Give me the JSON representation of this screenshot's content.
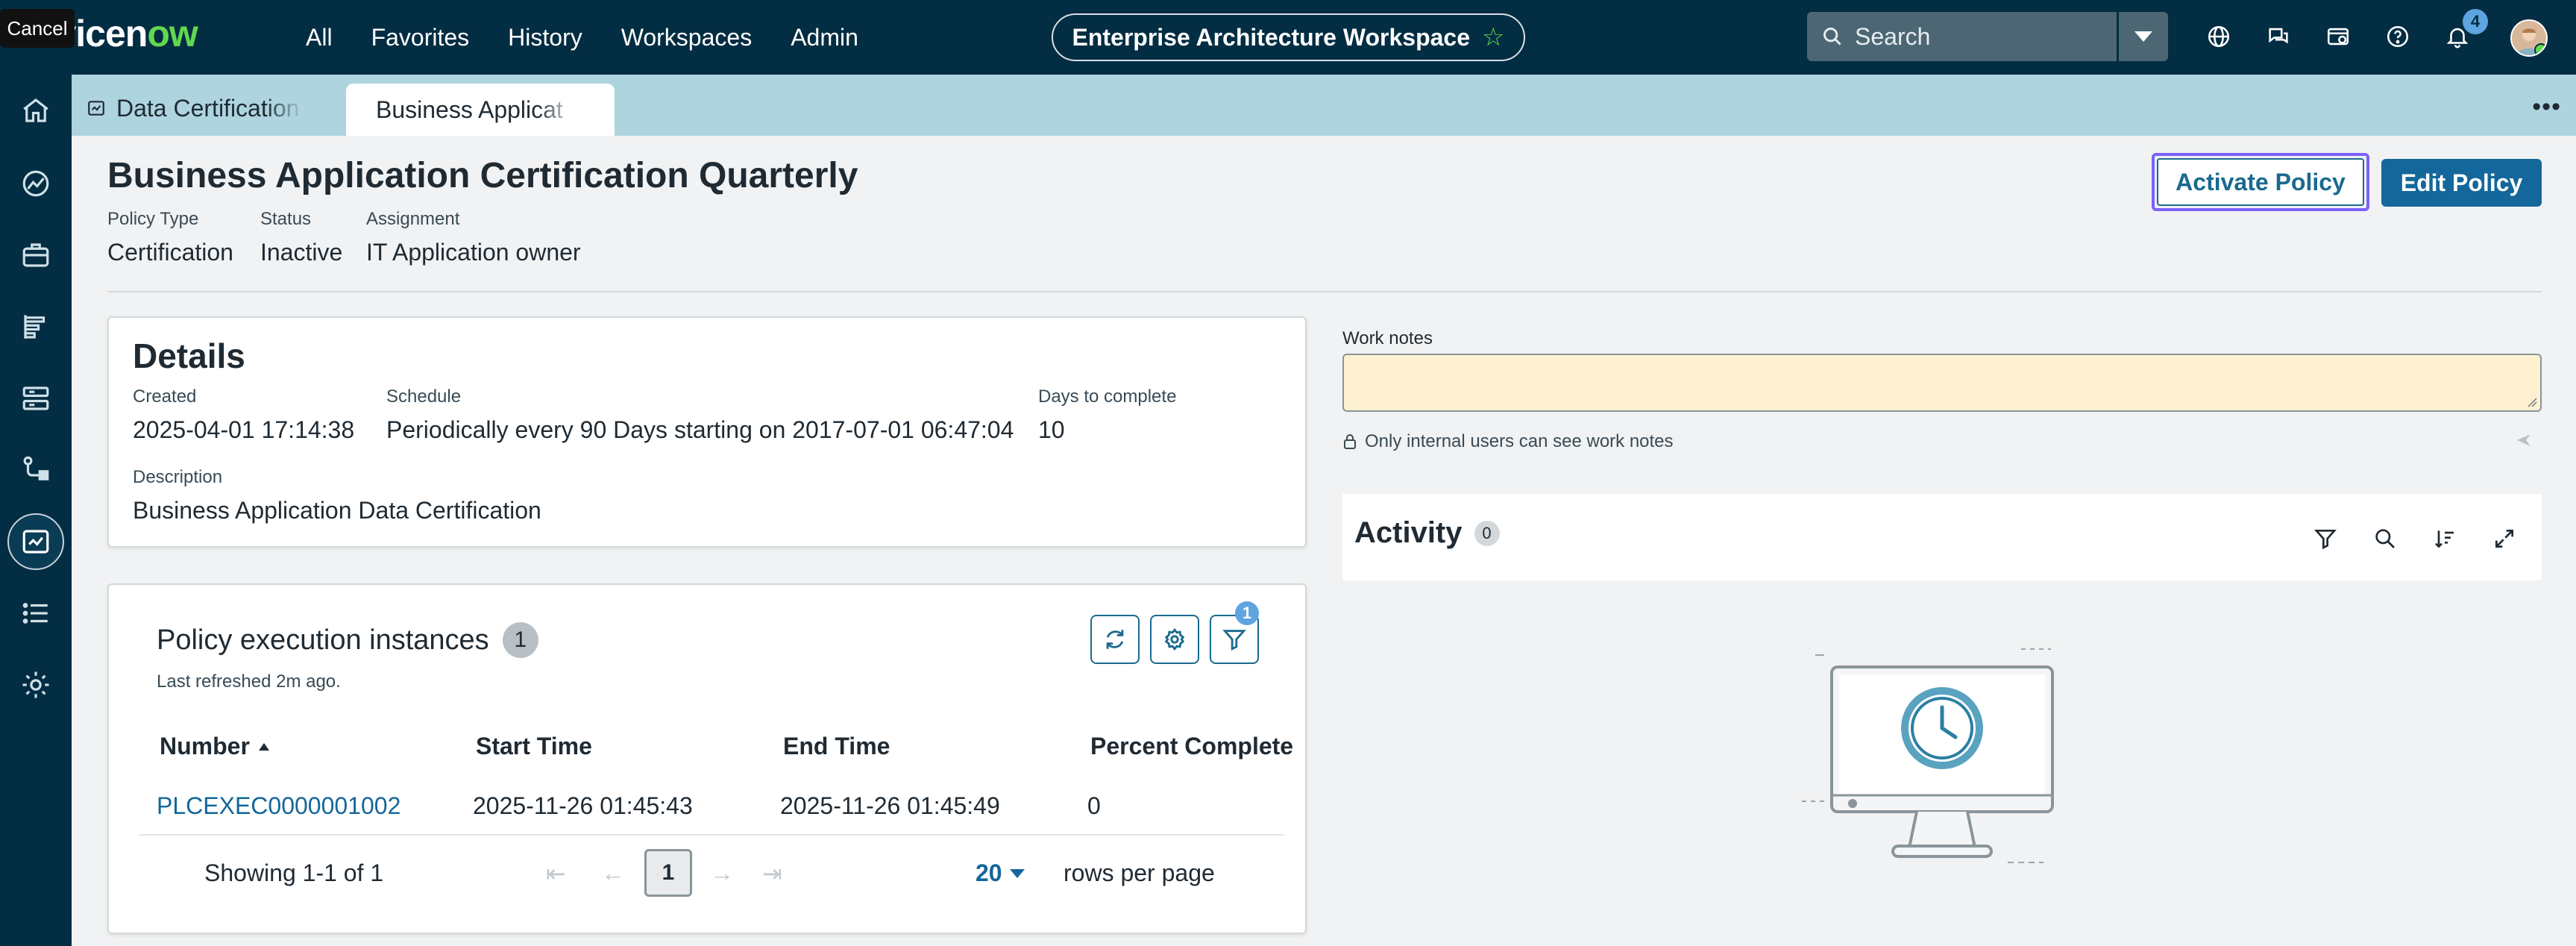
{
  "tooltip": {
    "cancel": "Cancel"
  },
  "brand": {
    "logo_pre": "rvicen",
    "logo_ow": "ow"
  },
  "nav": {
    "links": [
      "All",
      "Favorites",
      "History",
      "Workspaces",
      "Admin"
    ]
  },
  "workspace": {
    "title": "Enterprise Architecture Workspace",
    "icon": "star-icon"
  },
  "search": {
    "placeholder": "Search"
  },
  "notifications": {
    "count": "4"
  },
  "tabs": [
    {
      "label": "Data Certification",
      "icon": "certification-icon"
    },
    {
      "label": "Business Applicat"
    }
  ],
  "record": {
    "title": "Business Application Certification Quarterly",
    "policy_type_label": "Policy Type",
    "policy_type": "Certification",
    "status_label": "Status",
    "status": "Inactive",
    "assignment_label": "Assignment",
    "assignment": "IT Application owner",
    "activate_label": "Activate Policy",
    "edit_label": "Edit Policy"
  },
  "details": {
    "heading": "Details",
    "created_label": "Created",
    "created": "2025-04-01 17:14:38",
    "schedule_label": "Schedule",
    "schedule": "Periodically every 90 Days starting on 2017-07-01 06:47:04",
    "days_label": "Days to complete",
    "days": "10",
    "description_label": "Description",
    "description": "Business Application Data Certification"
  },
  "instances": {
    "title": "Policy execution instances",
    "count": "1",
    "refreshed": "Last refreshed 2m ago.",
    "filter_count": "1",
    "columns": [
      "Number",
      "Start Time",
      "End Time",
      "Percent Complete"
    ],
    "rows": [
      {
        "number": "PLCEXEC0000001002",
        "start": "2025-11-26 01:45:43",
        "end": "2025-11-26 01:45:49",
        "percent": "0"
      }
    ],
    "showing": "Showing 1-1 of 1",
    "page": "1",
    "rows_per_page_value": "20",
    "rows_per_page_label": "rows per page"
  },
  "work_notes": {
    "label": "Work notes",
    "hint": "Only internal users can see work notes"
  },
  "activity": {
    "title": "Activity",
    "count": "0"
  },
  "colors": {
    "nav_bg": "#032d42",
    "tabbar_bg": "#add4df",
    "accent": "#13679a",
    "focus": "#7b61ff",
    "work_notes_bg": "#fef1d2"
  }
}
